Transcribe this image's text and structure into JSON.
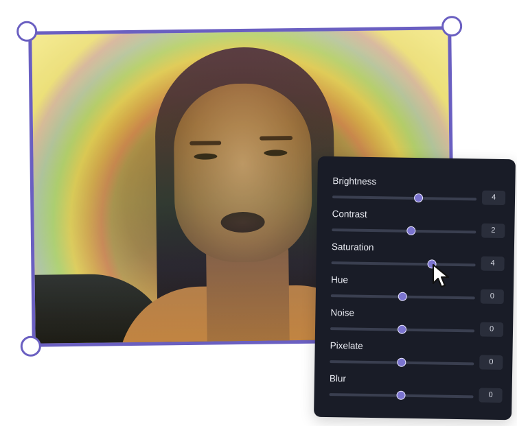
{
  "panel": {
    "sliders": [
      {
        "label": "Brightness",
        "value": "4",
        "level": 0.6
      },
      {
        "label": "Contrast",
        "value": "2",
        "level": 0.55
      },
      {
        "label": "Saturation",
        "value": "4",
        "level": 0.7
      },
      {
        "label": "Hue",
        "value": "0",
        "level": 0.5
      },
      {
        "label": "Noise",
        "value": "0",
        "level": 0.5
      },
      {
        "label": "Pixelate",
        "value": "0",
        "level": 0.5
      },
      {
        "label": "Blur",
        "value": "0",
        "level": 0.5
      }
    ]
  },
  "colors": {
    "accent": "#6a5fc1",
    "panel_bg": "#191c27",
    "knob": "#7b74cf"
  },
  "icons": {
    "cursor": "pointer-cursor-icon"
  }
}
